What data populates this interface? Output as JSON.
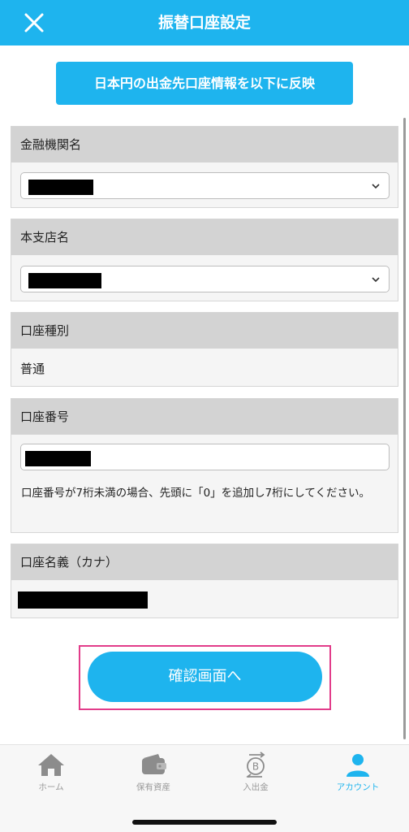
{
  "header": {
    "title": "振替口座設定",
    "close_icon": "close-icon"
  },
  "reflect_button": {
    "label": "日本円の出金先口座情報を以下に反映"
  },
  "sections": {
    "bank_name": {
      "label": "金融機関名"
    },
    "branch_name": {
      "label": "本支店名"
    },
    "account_type": {
      "label": "口座種別",
      "value": "普通"
    },
    "account_number": {
      "label": "口座番号",
      "note": "口座番号が7桁未満の場合、先頭に「0」を追加し7桁にしてください。"
    },
    "account_holder": {
      "label": "口座名義（カナ）"
    }
  },
  "confirm_button": {
    "label": "確認画面へ"
  },
  "tabbar": {
    "items": [
      {
        "label": "ホーム",
        "icon": "home-icon",
        "active": false
      },
      {
        "label": "保有資産",
        "icon": "wallet-icon",
        "active": false
      },
      {
        "label": "入出金",
        "icon": "bitcoin-transfer-icon",
        "active": false
      },
      {
        "label": "アカウント",
        "icon": "account-icon",
        "active": true
      }
    ]
  },
  "colors": {
    "brand": "#1eb4ee",
    "highlight": "#e23c8a",
    "section_header": "#d3d3d3",
    "inactive_tab": "#9a9a9a"
  }
}
